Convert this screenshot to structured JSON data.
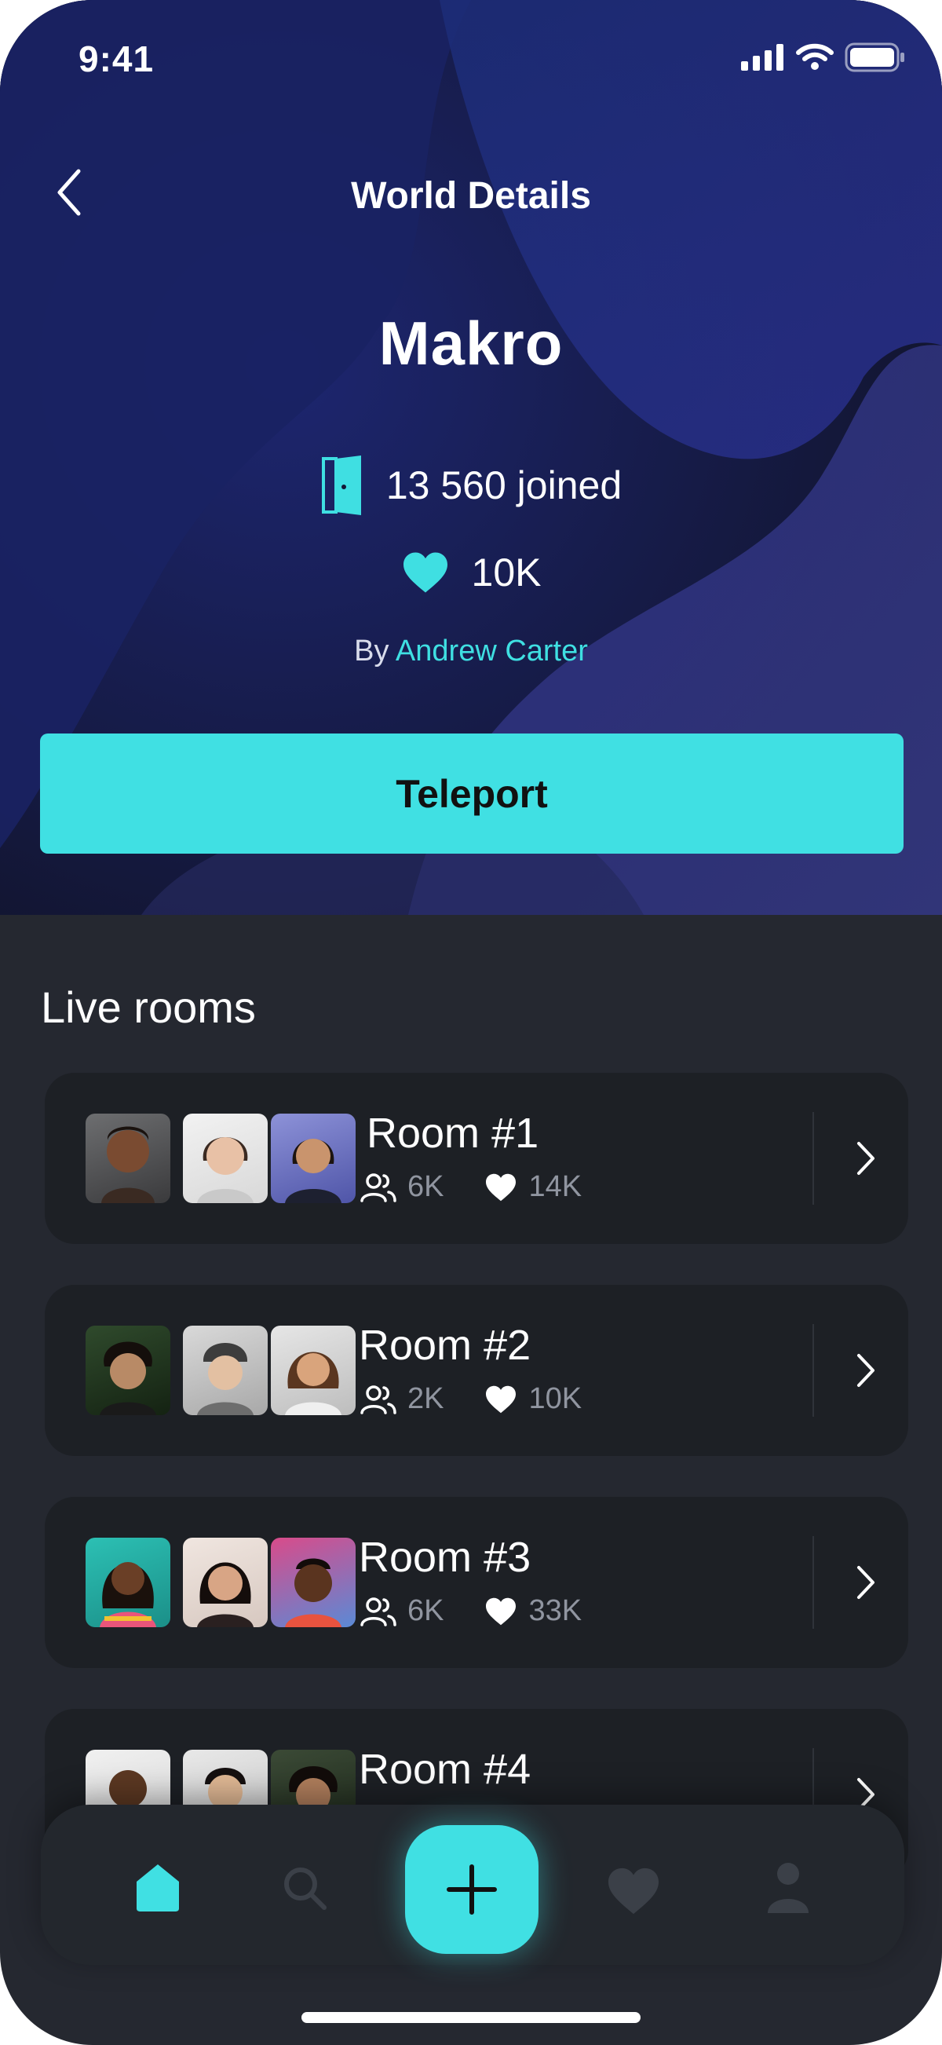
{
  "status_bar": {
    "time": "9:41"
  },
  "header": {
    "title": "World Details",
    "back_icon": "chevron-left-icon"
  },
  "world": {
    "name": "Makro",
    "joined": "13 560 joined",
    "likes": "10K",
    "by_prefix": "By",
    "author": "Andrew Carter"
  },
  "teleport_label": "Teleport",
  "live_rooms": {
    "title": "Live rooms",
    "rooms": [
      {
        "name": "Room #1",
        "members": "6K",
        "likes": "14K"
      },
      {
        "name": "Room #2",
        "members": "2K",
        "likes": "10K"
      },
      {
        "name": "Room #3",
        "members": "6K",
        "likes": "33K"
      },
      {
        "name": "Room #4",
        "members": "",
        "likes": ""
      }
    ]
  },
  "bottom_nav": {
    "items": [
      "home-icon",
      "search-icon",
      "plus-icon",
      "heart-icon",
      "profile-icon"
    ],
    "active": "home-icon"
  },
  "colors": {
    "accent": "#40e0e3",
    "hero_bg": "#141735",
    "page_bg": "#252830",
    "card_bg": "#1d2025",
    "muted_text": "#9095a0"
  }
}
